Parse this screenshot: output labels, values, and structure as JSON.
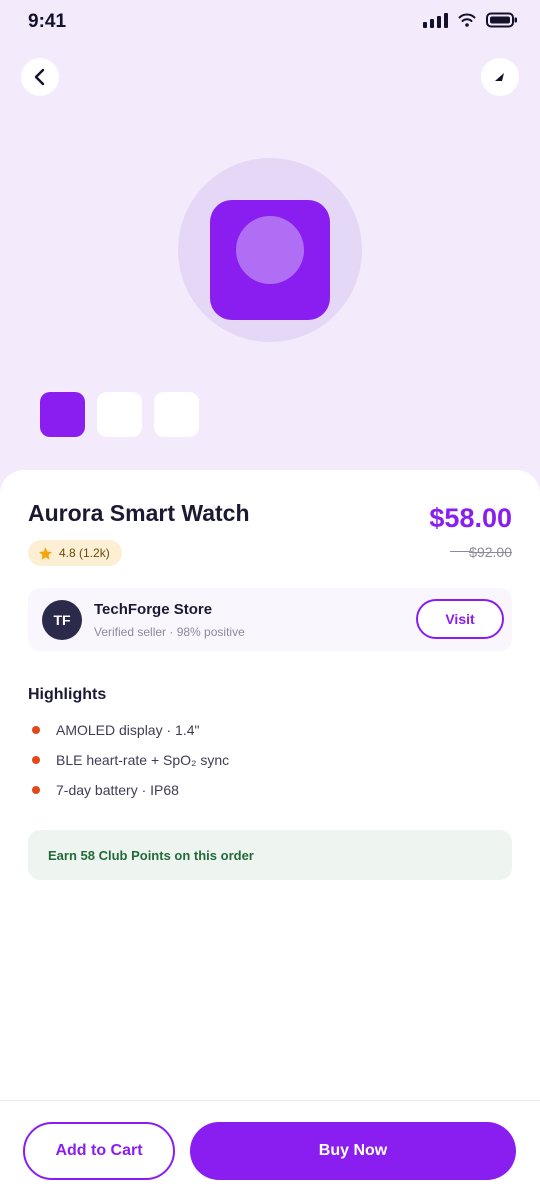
{
  "status_bar": {
    "time": "9:41"
  },
  "product": {
    "name": "Aurora Smart Watch",
    "rating": "4.8 (1.2k)",
    "price": "$58.00",
    "old_price": "$92.00",
    "gallery_count": 3,
    "gallery_selected": 1,
    "accent_color": "#8a1ef0"
  },
  "seller": {
    "initials": "TF",
    "name": "TechForge Store",
    "subtitle": "Verified seller · 98% positive",
    "visit_label": "Visit"
  },
  "highlights": {
    "title": "Highlights",
    "items": [
      "AMOLED display · 1.4\"",
      "BLE heart-rate + SpO₂ sync",
      "7-day battery · IP68"
    ]
  },
  "points_banner": "Earn 58 Club Points on this order",
  "actions": {
    "add_to_cart": "Add to Cart",
    "buy_now": "Buy Now"
  },
  "icons": {
    "back": "chevron-left-icon",
    "share": "share-icon",
    "star": "star-icon",
    "signal": "signal-icon",
    "wifi": "wifi-icon",
    "battery": "battery-icon"
  }
}
